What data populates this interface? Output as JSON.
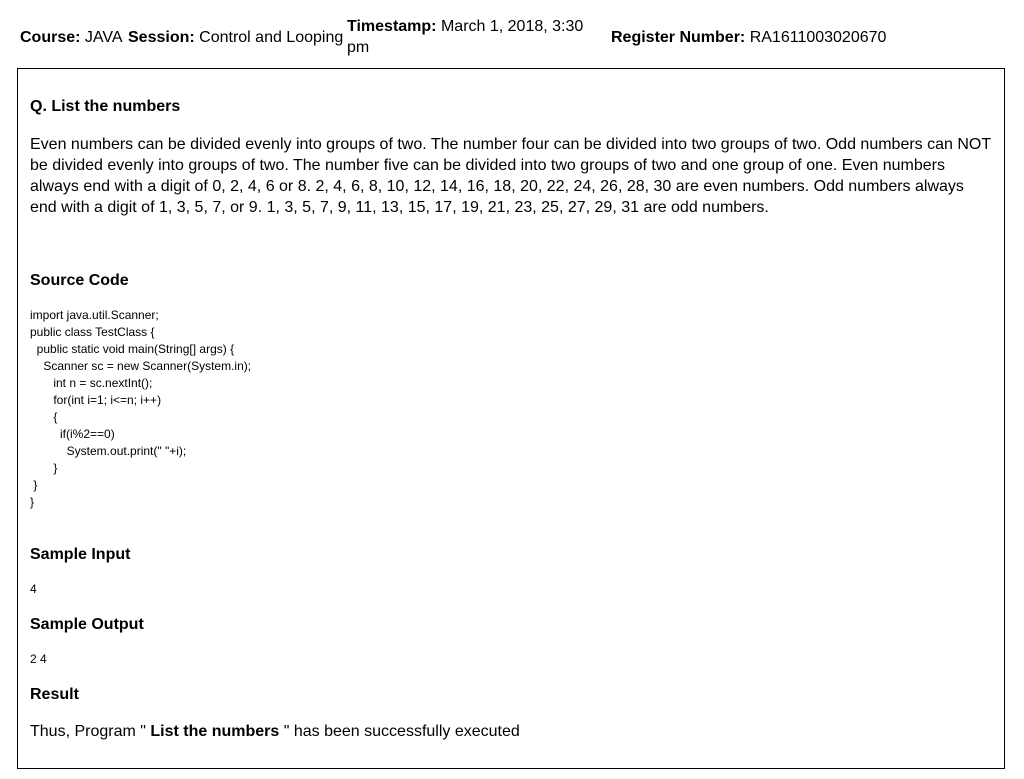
{
  "header": {
    "course_label": "Course:",
    "course_value": "JAVA",
    "session_label": "Session:",
    "session_value": "Control and Looping",
    "timestamp_label": "Timestamp:",
    "timestamp_value": "March 1, 2018, 3:30 pm",
    "register_label": "Register Number:",
    "register_value": "RA1611003020670"
  },
  "question": {
    "title": "Q. List the numbers",
    "body": "Even numbers can be divided evenly into groups of two. The number four can be divided into two groups of two. Odd numbers can NOT be divided evenly into groups of two. The number five can be divided into two groups of two and one group of one. Even numbers always end with a digit of 0, 2, 4, 6 or 8. 2, 4, 6, 8, 10, 12, 14, 16, 18, 20, 22, 24, 26, 28, 30 are even numbers. Odd numbers always end with a digit of 1, 3, 5, 7, or 9. 1, 3, 5, 7, 9, 11, 13, 15, 17, 19, 21, 23, 25, 27, 29, 31 are odd numbers."
  },
  "source": {
    "heading": "Source Code",
    "code": "import java.util.Scanner;\npublic class TestClass {\n  public static void main(String[] args) {\n    Scanner sc = new Scanner(System.in);\n       int n = sc.nextInt();\n       for(int i=1; i<=n; i++)\n       {\n         if(i%2==0)\n           System.out.print(\" \"+i);\n       }\n }\n}"
  },
  "sample_input": {
    "heading": "Sample Input",
    "value": "4"
  },
  "sample_output": {
    "heading": "Sample Output",
    "value": "2 4"
  },
  "result": {
    "heading": "Result",
    "prefix": "Thus, Program \"",
    "program_name": " List the numbers ",
    "suffix": "\" has been successfully executed"
  }
}
